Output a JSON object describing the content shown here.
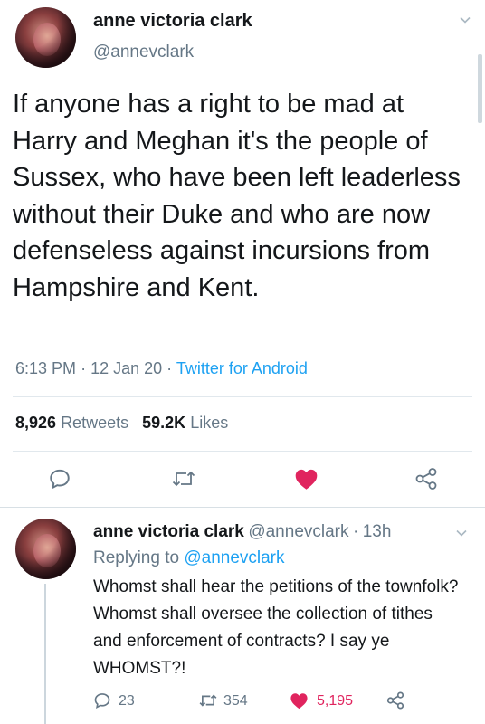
{
  "tweet": {
    "author_name": "anne victoria clark",
    "author_handle": "@annevclark",
    "text": "If anyone has a right to be mad at Harry and Meghan it's the people of Sussex, who have been left leaderless without their Duke and who are now defenseless against incursions from Hampshire and Kent.",
    "time": "6:13 PM",
    "date": "12 Jan 20",
    "separator": "·",
    "source": "Twitter for Android",
    "retweets_count": "8,926",
    "retweets_label": "Retweets",
    "likes_count": "59.2K",
    "likes_label": "Likes",
    "menu_icon": "chevron-down-icon",
    "liked": true,
    "like_color": "#e0245e"
  },
  "reply": {
    "author_name": "anne victoria clark",
    "author_handle": "@annevclark",
    "separator": "·",
    "age": "13h",
    "replying_label": "Replying to",
    "replying_to": "@annevclark",
    "text": "Whomst shall hear the petitions of the townfolk? Whomst shall oversee the collection of tithes and enforcement of contracts? I say ye WHOMST?!",
    "reply_count": "23",
    "retweet_count": "354",
    "like_count": "5,195",
    "liked": true
  },
  "colors": {
    "link": "#1da1f2",
    "secondary_text": "#657786",
    "primary_text": "#14171a",
    "like": "#e0245e",
    "divider": "#e1e8ed"
  }
}
